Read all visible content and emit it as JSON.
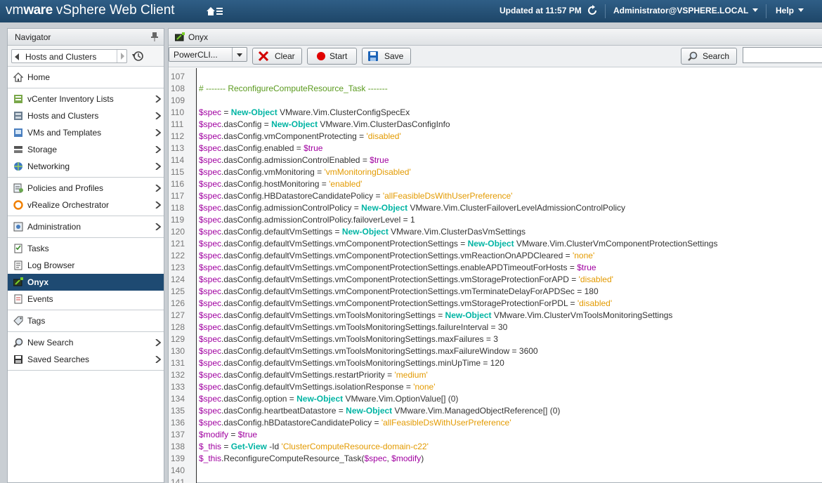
{
  "topbar": {
    "brand_vm": "vm",
    "brand_ware": "ware",
    "brand_product": "vSphere Web Client",
    "updated": "Updated at 11:57 PM",
    "user": "Administrator@VSPHERE.LOCAL",
    "help": "Help"
  },
  "navigator": {
    "title": "Navigator",
    "history_label": "Hosts and Clusters",
    "groups": [
      [
        {
          "label": "Home",
          "icon": "home-icon",
          "chevron": false
        }
      ],
      [
        {
          "label": "vCenter Inventory Lists",
          "icon": "inventory-icon",
          "chevron": true
        },
        {
          "label": "Hosts and Clusters",
          "icon": "hosts-clusters-icon",
          "chevron": true
        },
        {
          "label": "VMs and Templates",
          "icon": "vms-icon",
          "chevron": true
        },
        {
          "label": "Storage",
          "icon": "storage-icon",
          "chevron": true
        },
        {
          "label": "Networking",
          "icon": "networking-icon",
          "chevron": true
        }
      ],
      [
        {
          "label": "Policies and Profiles",
          "icon": "policies-icon",
          "chevron": true
        },
        {
          "label": "vRealize Orchestrator",
          "icon": "orchestrator-icon",
          "chevron": true
        }
      ],
      [
        {
          "label": "Administration",
          "icon": "administration-icon",
          "chevron": true
        }
      ],
      [
        {
          "label": "Tasks",
          "icon": "tasks-icon",
          "chevron": false
        },
        {
          "label": "Log Browser",
          "icon": "log-browser-icon",
          "chevron": false
        },
        {
          "label": "Onyx",
          "icon": "onyx-icon",
          "chevron": false,
          "active": true
        },
        {
          "label": "Events",
          "icon": "events-icon",
          "chevron": false
        }
      ],
      [
        {
          "label": "Tags",
          "icon": "tags-icon",
          "chevron": false
        }
      ],
      [
        {
          "label": "New Search",
          "icon": "search-icon",
          "chevron": true
        },
        {
          "label": "Saved Searches",
          "icon": "saved-searches-icon",
          "chevron": true
        }
      ]
    ]
  },
  "main": {
    "title": "Onyx",
    "toolbar": {
      "combo_value": "PowerCLI...",
      "clear": "Clear",
      "start": "Start",
      "save": "Save",
      "search": "Search",
      "search_value": ""
    },
    "code": {
      "first_line": 107,
      "lines": [
        [],
        [
          [
            "c",
            "# ------- ReconfigureComputeResource_Task -------"
          ]
        ],
        [],
        [
          [
            "v",
            "$spec"
          ],
          [
            "t",
            " = "
          ],
          [
            "k",
            "New-Object"
          ],
          [
            "t",
            " VMware.Vim.ClusterConfigSpecEx"
          ]
        ],
        [
          [
            "v",
            "$spec"
          ],
          [
            "t",
            ".dasConfig = "
          ],
          [
            "k",
            "New-Object"
          ],
          [
            "t",
            " VMware.Vim.ClusterDasConfigInfo"
          ]
        ],
        [
          [
            "v",
            "$spec"
          ],
          [
            "t",
            ".dasConfig.vmComponentProtecting = "
          ],
          [
            "s",
            "'disabled'"
          ]
        ],
        [
          [
            "v",
            "$spec"
          ],
          [
            "t",
            ".dasConfig.enabled = "
          ],
          [
            "v",
            "$true"
          ]
        ],
        [
          [
            "v",
            "$spec"
          ],
          [
            "t",
            ".dasConfig.admissionControlEnabled = "
          ],
          [
            "v",
            "$true"
          ]
        ],
        [
          [
            "v",
            "$spec"
          ],
          [
            "t",
            ".dasConfig.vmMonitoring = "
          ],
          [
            "s",
            "'vmMonitoringDisabled'"
          ]
        ],
        [
          [
            "v",
            "$spec"
          ],
          [
            "t",
            ".dasConfig.hostMonitoring = "
          ],
          [
            "s",
            "'enabled'"
          ]
        ],
        [
          [
            "v",
            "$spec"
          ],
          [
            "t",
            ".dasConfig.HBDatastoreCandidatePolicy = "
          ],
          [
            "s",
            "'allFeasibleDsWithUserPreference'"
          ]
        ],
        [
          [
            "v",
            "$spec"
          ],
          [
            "t",
            ".dasConfig.admissionControlPolicy = "
          ],
          [
            "k",
            "New-Object"
          ],
          [
            "t",
            " VMware.Vim.ClusterFailoverLevelAdmissionControlPolicy"
          ]
        ],
        [
          [
            "v",
            "$spec"
          ],
          [
            "t",
            ".dasConfig.admissionControlPolicy.failoverLevel = 1"
          ]
        ],
        [
          [
            "v",
            "$spec"
          ],
          [
            "t",
            ".dasConfig.defaultVmSettings = "
          ],
          [
            "k",
            "New-Object"
          ],
          [
            "t",
            " VMware.Vim.ClusterDasVmSettings"
          ]
        ],
        [
          [
            "v",
            "$spec"
          ],
          [
            "t",
            ".dasConfig.defaultVmSettings.vmComponentProtectionSettings = "
          ],
          [
            "k",
            "New-Object"
          ],
          [
            "t",
            " VMware.Vim.ClusterVmComponentProtectionSettings"
          ]
        ],
        [
          [
            "v",
            "$spec"
          ],
          [
            "t",
            ".dasConfig.defaultVmSettings.vmComponentProtectionSettings.vmReactionOnAPDCleared = "
          ],
          [
            "s",
            "'none'"
          ]
        ],
        [
          [
            "v",
            "$spec"
          ],
          [
            "t",
            ".dasConfig.defaultVmSettings.vmComponentProtectionSettings.enableAPDTimeoutForHosts = "
          ],
          [
            "v",
            "$true"
          ]
        ],
        [
          [
            "v",
            "$spec"
          ],
          [
            "t",
            ".dasConfig.defaultVmSettings.vmComponentProtectionSettings.vmStorageProtectionForAPD = "
          ],
          [
            "s",
            "'disabled'"
          ]
        ],
        [
          [
            "v",
            "$spec"
          ],
          [
            "t",
            ".dasConfig.defaultVmSettings.vmComponentProtectionSettings.vmTerminateDelayForAPDSec = 180"
          ]
        ],
        [
          [
            "v",
            "$spec"
          ],
          [
            "t",
            ".dasConfig.defaultVmSettings.vmComponentProtectionSettings.vmStorageProtectionForPDL = "
          ],
          [
            "s",
            "'disabled'"
          ]
        ],
        [
          [
            "v",
            "$spec"
          ],
          [
            "t",
            ".dasConfig.defaultVmSettings.vmToolsMonitoringSettings = "
          ],
          [
            "k",
            "New-Object"
          ],
          [
            "t",
            " VMware.Vim.ClusterVmToolsMonitoringSettings"
          ]
        ],
        [
          [
            "v",
            "$spec"
          ],
          [
            "t",
            ".dasConfig.defaultVmSettings.vmToolsMonitoringSettings.failureInterval = 30"
          ]
        ],
        [
          [
            "v",
            "$spec"
          ],
          [
            "t",
            ".dasConfig.defaultVmSettings.vmToolsMonitoringSettings.maxFailures = 3"
          ]
        ],
        [
          [
            "v",
            "$spec"
          ],
          [
            "t",
            ".dasConfig.defaultVmSettings.vmToolsMonitoringSettings.maxFailureWindow = 3600"
          ]
        ],
        [
          [
            "v",
            "$spec"
          ],
          [
            "t",
            ".dasConfig.defaultVmSettings.vmToolsMonitoringSettings.minUpTime = 120"
          ]
        ],
        [
          [
            "v",
            "$spec"
          ],
          [
            "t",
            ".dasConfig.defaultVmSettings.restartPriority = "
          ],
          [
            "s",
            "'medium'"
          ]
        ],
        [
          [
            "v",
            "$spec"
          ],
          [
            "t",
            ".dasConfig.defaultVmSettings.isolationResponse = "
          ],
          [
            "s",
            "'none'"
          ]
        ],
        [
          [
            "v",
            "$spec"
          ],
          [
            "t",
            ".dasConfig.option = "
          ],
          [
            "k",
            "New-Object"
          ],
          [
            "t",
            " VMware.Vim.OptionValue[] (0)"
          ]
        ],
        [
          [
            "v",
            "$spec"
          ],
          [
            "t",
            ".dasConfig.heartbeatDatastore = "
          ],
          [
            "k",
            "New-Object"
          ],
          [
            "t",
            " VMware.Vim.ManagedObjectReference[] (0)"
          ]
        ],
        [
          [
            "v",
            "$spec"
          ],
          [
            "t",
            ".dasConfig.hBDatastoreCandidatePolicy = "
          ],
          [
            "s",
            "'allFeasibleDsWithUserPreference'"
          ]
        ],
        [
          [
            "v",
            "$modify"
          ],
          [
            "t",
            " = "
          ],
          [
            "v",
            "$true"
          ]
        ],
        [
          [
            "v",
            "$_this"
          ],
          [
            "t",
            " = "
          ],
          [
            "k",
            "Get-View"
          ],
          [
            "t",
            " -Id "
          ],
          [
            "s",
            "'ClusterComputeResource-domain-c22'"
          ]
        ],
        [
          [
            "v",
            "$_this"
          ],
          [
            "t",
            ".ReconfigureComputeResource_Task("
          ],
          [
            "v",
            "$spec"
          ],
          [
            "t",
            ", "
          ],
          [
            "v",
            "$modify"
          ],
          [
            "t",
            ")"
          ]
        ],
        [],
        []
      ]
    }
  },
  "colors": {
    "variable": "#a000a0",
    "keyword": "#00b4a3",
    "string": "#e39a00",
    "comment": "#5a9a1e",
    "topbar": "#1e4668",
    "nav_active": "#1e4a72"
  }
}
